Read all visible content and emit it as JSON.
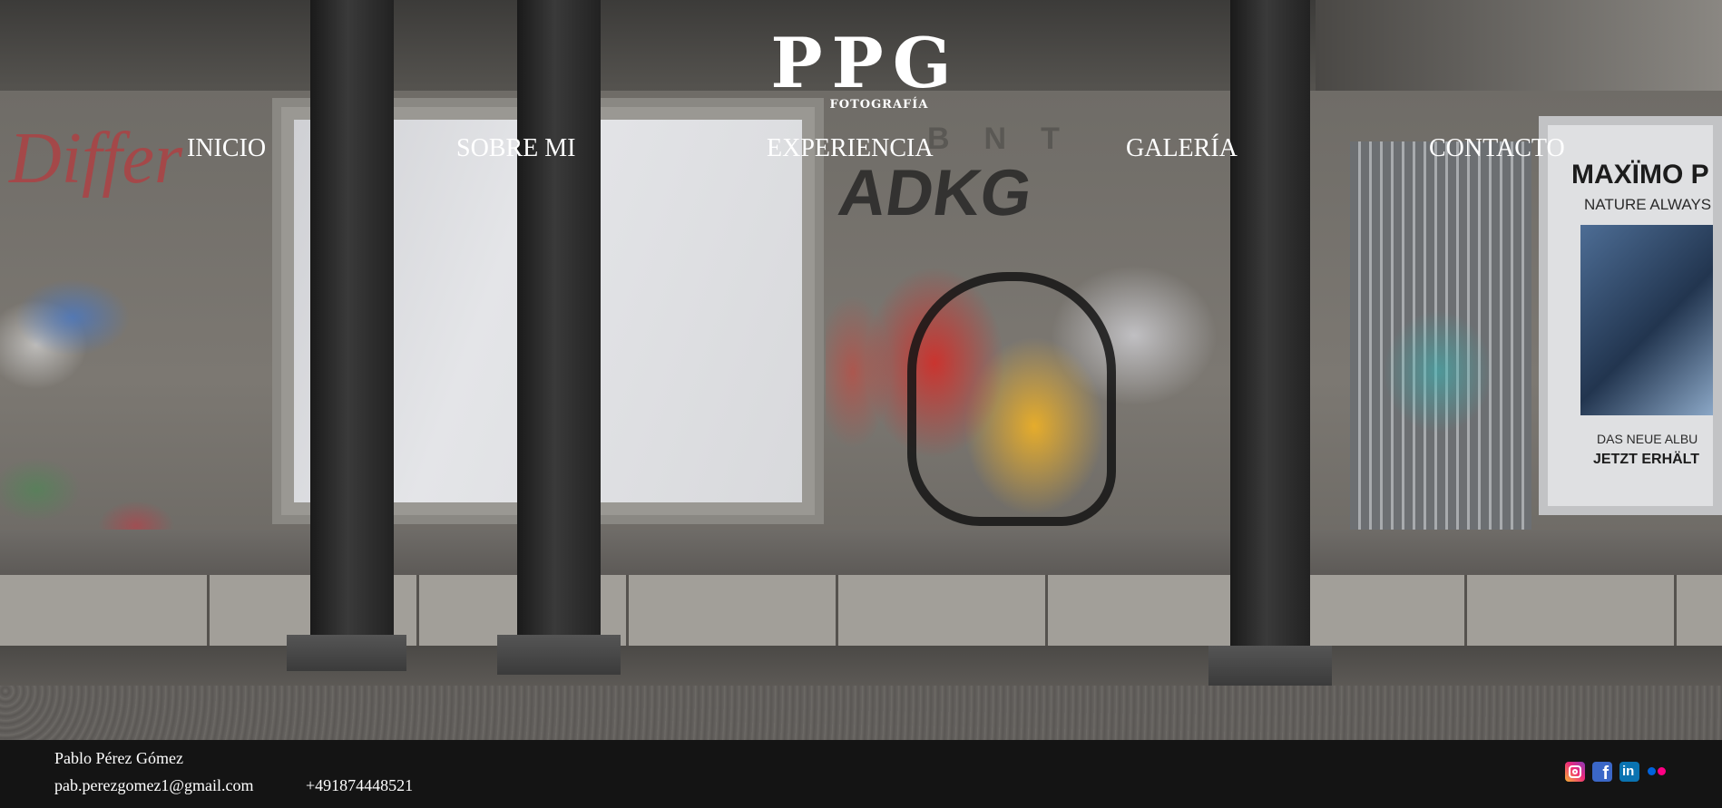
{
  "brand": {
    "logo_mark": "PPG",
    "logo_subtitle": "FOTOGRAFÍA"
  },
  "nav": {
    "items": [
      {
        "label": "INICIO"
      },
      {
        "label": "SOBRE MI"
      },
      {
        "label": "EXPERIENCIA"
      },
      {
        "label": "GALERÍA"
      },
      {
        "label": "CONTACTO"
      }
    ]
  },
  "hero_photo": {
    "wall_letters": "BNT",
    "tag_red": "Differ",
    "tag_dark": "ADKG",
    "poster": {
      "headline": "MAXÏMO P",
      "tagline": "NATURE ALWAYS",
      "small_line": "DAS NEUE ALBU",
      "bold_line": "JETZT ERHÄLT"
    }
  },
  "footer": {
    "name": "Pablo Pérez Gómez",
    "email": "pab.perezgomez1@gmail.com",
    "phone": "+491874448521",
    "social": [
      {
        "icon": "instagram-icon",
        "color": "#ee2a7b"
      },
      {
        "icon": "facebook-icon",
        "color": "#3b67c7"
      },
      {
        "icon": "linkedin-icon",
        "color": "#0a73b1"
      },
      {
        "icon": "flickr-icon",
        "color": "#ff0084"
      }
    ]
  },
  "colors": {
    "nav_text": "#ffffff",
    "footer_bg": "#141414",
    "footer_text": "#ffffff"
  }
}
